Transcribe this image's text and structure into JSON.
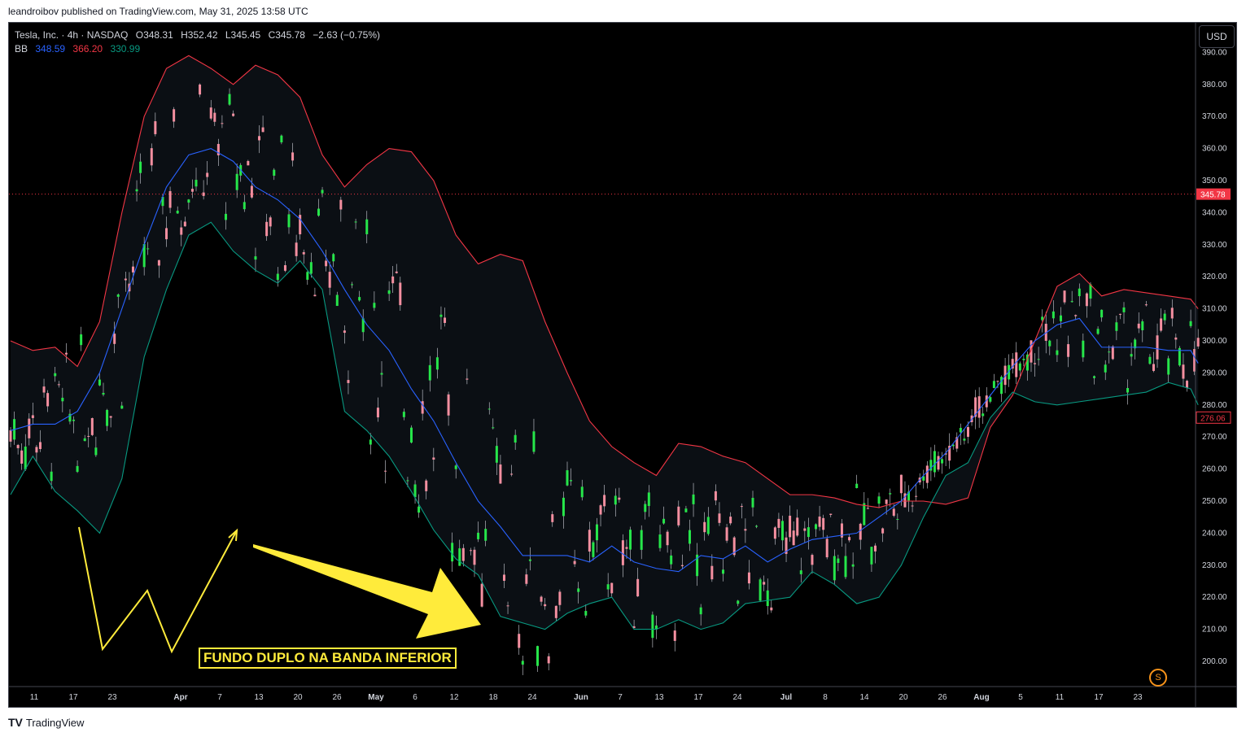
{
  "header": {
    "publisher": "leandroibov published on TradingView.com, May 31, 2025 13:58 UTC"
  },
  "legend": {
    "symbol_line": "Tesla, Inc. · 4h · NASDAQ",
    "ohlc": {
      "open": "O348.31",
      "high": "H352.42",
      "low": "L345.45",
      "close": "C345.78",
      "change": "−2.63 (−0.75%)"
    },
    "bb_label": "BB",
    "bb_values": {
      "basis": "348.59",
      "upper": "366.20",
      "lower": "330.99"
    }
  },
  "toolbar": {
    "currency": "USD"
  },
  "annotation": {
    "text": "FUNDO DUPLO NA BANDA INFERIOR",
    "badge": "S"
  },
  "footer": {
    "brand": "TradingView"
  },
  "colors": {
    "background": "#000000",
    "up": "#26e64a",
    "down": "#f48fa0",
    "basis": "#2962ff",
    "upper": "#f23645",
    "lower": "#089981",
    "band_fill": "#0b0f14",
    "annotation": "#ffeb3b",
    "price_line": "#f23645"
  },
  "chart_data": {
    "type": "candlestick",
    "title": "",
    "xlabel": "",
    "ylabel": "",
    "x_ticks": [
      "11",
      "17",
      "23",
      "Apr",
      "7",
      "13",
      "20",
      "26",
      "May",
      "6",
      "12",
      "18",
      "24",
      "Jun",
      "7",
      "13",
      "17",
      "24",
      "Jul",
      "8",
      "14",
      "20",
      "26",
      "Aug",
      "5",
      "11",
      "17",
      "23"
    ],
    "y_ticks": [
      "200.00",
      "210.00",
      "220.00",
      "230.00",
      "240.00",
      "250.00",
      "260.00",
      "270.00",
      "280.00",
      "290.00",
      "300.00",
      "310.00",
      "320.00",
      "330.00",
      "340.00",
      "350.00",
      "360.00",
      "370.00",
      "380.00",
      "390.00"
    ],
    "ylim": [
      198,
      392
    ],
    "price_labels": {
      "last": "345.78",
      "current": "276.06"
    },
    "price_line": 345.78,
    "current_price": 276.06,
    "bb_upper": [
      [
        0,
        300
      ],
      [
        6,
        297
      ],
      [
        12,
        298
      ],
      [
        18,
        292
      ],
      [
        24,
        306
      ],
      [
        30,
        340
      ],
      [
        36,
        370
      ],
      [
        42,
        385
      ],
      [
        48,
        389
      ],
      [
        54,
        385
      ],
      [
        60,
        380
      ],
      [
        66,
        386
      ],
      [
        72,
        383
      ],
      [
        78,
        376
      ],
      [
        84,
        358
      ],
      [
        90,
        348
      ],
      [
        96,
        355
      ],
      [
        102,
        360
      ],
      [
        108,
        359
      ],
      [
        114,
        350
      ],
      [
        120,
        333
      ],
      [
        126,
        324
      ],
      [
        132,
        327
      ],
      [
        138,
        325
      ],
      [
        144,
        306
      ],
      [
        150,
        290
      ],
      [
        156,
        275
      ],
      [
        162,
        267
      ],
      [
        168,
        262
      ],
      [
        174,
        258
      ],
      [
        180,
        268
      ],
      [
        186,
        267
      ],
      [
        192,
        264
      ],
      [
        198,
        262
      ],
      [
        204,
        257
      ],
      [
        210,
        252
      ],
      [
        216,
        252
      ],
      [
        222,
        251
      ],
      [
        228,
        249
      ],
      [
        234,
        248
      ],
      [
        240,
        250
      ],
      [
        246,
        250
      ],
      [
        252,
        249
      ],
      [
        258,
        251
      ],
      [
        264,
        273
      ],
      [
        270,
        283
      ],
      [
        276,
        300
      ],
      [
        282,
        317
      ],
      [
        288,
        321
      ],
      [
        294,
        314
      ],
      [
        300,
        316
      ],
      [
        306,
        315
      ],
      [
        312,
        314
      ],
      [
        318,
        313
      ],
      [
        320,
        310
      ]
    ],
    "bb_basis": [
      [
        0,
        272
      ],
      [
        6,
        274
      ],
      [
        12,
        274
      ],
      [
        18,
        278
      ],
      [
        24,
        290
      ],
      [
        30,
        310
      ],
      [
        36,
        330
      ],
      [
        42,
        348
      ],
      [
        48,
        358
      ],
      [
        54,
        360
      ],
      [
        60,
        356
      ],
      [
        66,
        348
      ],
      [
        72,
        344
      ],
      [
        78,
        338
      ],
      [
        84,
        328
      ],
      [
        90,
        316
      ],
      [
        96,
        305
      ],
      [
        102,
        297
      ],
      [
        108,
        285
      ],
      [
        114,
        275
      ],
      [
        120,
        262
      ],
      [
        126,
        250
      ],
      [
        132,
        242
      ],
      [
        138,
        233
      ],
      [
        144,
        233
      ],
      [
        150,
        233
      ],
      [
        156,
        231
      ],
      [
        162,
        236
      ],
      [
        168,
        231
      ],
      [
        174,
        229
      ],
      [
        180,
        228
      ],
      [
        186,
        233
      ],
      [
        192,
        232
      ],
      [
        198,
        236
      ],
      [
        204,
        231
      ],
      [
        210,
        235
      ],
      [
        216,
        238
      ],
      [
        222,
        239
      ],
      [
        228,
        240
      ],
      [
        234,
        245
      ],
      [
        240,
        250
      ],
      [
        246,
        258
      ],
      [
        252,
        265
      ],
      [
        258,
        274
      ],
      [
        264,
        283
      ],
      [
        270,
        292
      ],
      [
        276,
        300
      ],
      [
        282,
        305
      ],
      [
        288,
        307
      ],
      [
        294,
        298
      ],
      [
        300,
        298
      ],
      [
        306,
        298
      ],
      [
        312,
        297
      ],
      [
        318,
        297
      ],
      [
        320,
        293
      ]
    ],
    "bb_lower": [
      [
        0,
        252
      ],
      [
        6,
        264
      ],
      [
        12,
        253
      ],
      [
        18,
        247
      ],
      [
        24,
        240
      ],
      [
        30,
        257
      ],
      [
        36,
        295
      ],
      [
        42,
        316
      ],
      [
        48,
        333
      ],
      [
        54,
        337
      ],
      [
        60,
        328
      ],
      [
        66,
        322
      ],
      [
        72,
        318
      ],
      [
        78,
        325
      ],
      [
        84,
        316
      ],
      [
        90,
        278
      ],
      [
        96,
        272
      ],
      [
        102,
        264
      ],
      [
        108,
        253
      ],
      [
        114,
        241
      ],
      [
        120,
        232
      ],
      [
        126,
        227
      ],
      [
        132,
        214
      ],
      [
        138,
        212
      ],
      [
        144,
        210
      ],
      [
        150,
        215
      ],
      [
        156,
        218
      ],
      [
        162,
        220
      ],
      [
        168,
        210
      ],
      [
        174,
        210
      ],
      [
        180,
        213
      ],
      [
        186,
        210
      ],
      [
        192,
        212
      ],
      [
        198,
        218
      ],
      [
        204,
        219
      ],
      [
        210,
        220
      ],
      [
        216,
        228
      ],
      [
        222,
        224
      ],
      [
        228,
        218
      ],
      [
        234,
        220
      ],
      [
        240,
        230
      ],
      [
        246,
        245
      ],
      [
        252,
        258
      ],
      [
        258,
        262
      ],
      [
        264,
        276
      ],
      [
        270,
        284
      ],
      [
        276,
        281
      ],
      [
        282,
        280
      ],
      [
        288,
        281
      ],
      [
        294,
        282
      ],
      [
        300,
        283
      ],
      [
        306,
        284
      ],
      [
        312,
        287
      ],
      [
        318,
        285
      ],
      [
        320,
        280
      ]
    ]
  }
}
